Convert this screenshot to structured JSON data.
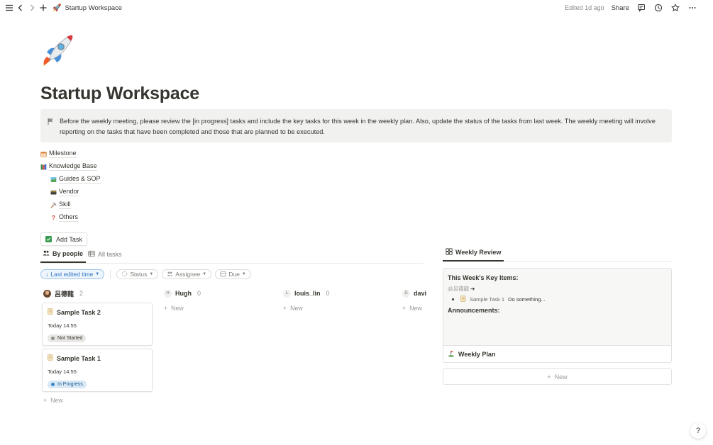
{
  "topbar": {
    "breadcrumb_title": "Startup Workspace",
    "edited": "Edited 1d ago",
    "share": "Share"
  },
  "page": {
    "title": "Startup Workspace",
    "callout": "Before the weekly meeting, please review the [in progress] tasks and include the key tasks for this week in the weekly plan. Also, update the status of the tasks from last week. The weekly meeting will involve reporting on the tasks that have been completed and those that are planned to be executed."
  },
  "links": [
    {
      "label": "Milestone",
      "icon": "calendar-icon"
    },
    {
      "label": "Knowledge Base",
      "icon": "books-icon"
    },
    {
      "label": "Guides & SOP",
      "icon": "map-icon"
    },
    {
      "label": "Vendor",
      "icon": "card-icon"
    },
    {
      "label": "Skill",
      "icon": "pickaxe-icon"
    },
    {
      "label": "Others",
      "icon": "question-icon"
    }
  ],
  "add_task": "Add Task",
  "tabs": [
    "By people",
    "All tasks"
  ],
  "filters": [
    "Last edited time",
    "Status",
    "Assignee",
    "Due"
  ],
  "board": {
    "columns": [
      {
        "name": "呂德龍",
        "count": "2",
        "new": "New",
        "cards": [
          {
            "title": "Sample Task 2",
            "date": "Today 14:55",
            "status": "Not Started"
          },
          {
            "title": "Sample Task 1",
            "date": "Today 14:55",
            "status": "In Progress"
          }
        ]
      },
      {
        "name": "Hugh",
        "initial": "H",
        "count": "0",
        "new": "New"
      },
      {
        "name": "louis_lin",
        "initial": "L",
        "count": "0",
        "new": "New"
      },
      {
        "name": "davi",
        "initial": "D",
        "new": "New"
      }
    ]
  },
  "right": {
    "tab": "Weekly Review",
    "key_items_heading": "This Week's Key Items:",
    "mention": "@呂德龍",
    "bullet_task": "Sample Task 1",
    "bullet_note": "Do something...",
    "announcements": "Announcements:",
    "weekly_plan": "Weekly Plan",
    "new": "New"
  },
  "help": "?",
  "colors": {
    "accent_blue": "#2b74c4",
    "status_gray": "#e8e7e4",
    "status_blue": "#d8e8f5",
    "callout_bg": "#f1f1ef"
  }
}
